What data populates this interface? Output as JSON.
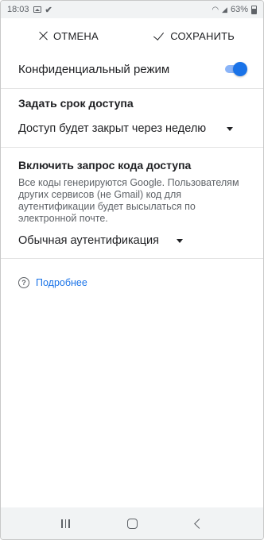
{
  "status_bar": {
    "time": "18:03",
    "battery": "63%"
  },
  "action_bar": {
    "cancel_label": "ОТМЕНА",
    "save_label": "СОХРАНИТЬ"
  },
  "confidential": {
    "label": "Конфиденциальный режим",
    "enabled": true
  },
  "expiry": {
    "title": "Задать срок доступа",
    "selected": "Доступ будет закрыт через неделю"
  },
  "passcode": {
    "title": "Включить запрос кода доступа",
    "description": "Все коды генерируются Google. Пользователям других сервисов (не Gmail) код для аутентификации будет высылаться по электронной почте.",
    "selected": "Обычная аутентификация"
  },
  "learn_more": {
    "label": "Подробнее"
  },
  "colors": {
    "accent": "#1a73e8",
    "toggle_track": "#8ab4f8"
  },
  "icons": {
    "cancel": "close-icon",
    "save": "check-icon",
    "help": "help-circle-icon"
  }
}
